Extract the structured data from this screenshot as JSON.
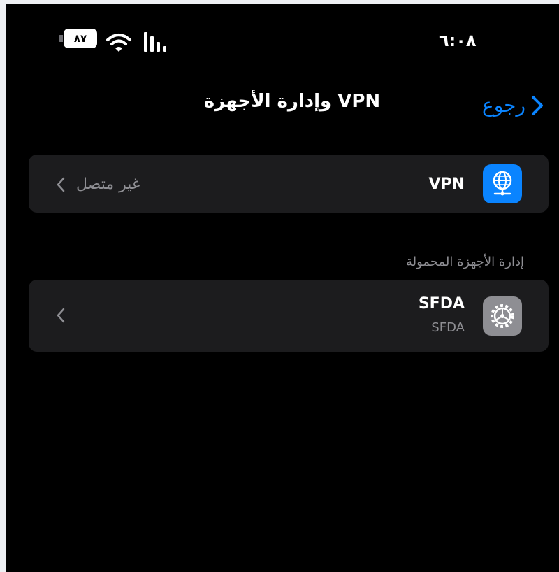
{
  "status_bar": {
    "battery": "٨٧",
    "time": "٦:٠٨",
    "icons": [
      "battery-icon",
      "wifi-icon",
      "cellular-signal-icon"
    ]
  },
  "nav": {
    "back_label": "رجوع",
    "title": "VPN وإدارة الأجهزة"
  },
  "vpn_row": {
    "icon": "globe-network-icon",
    "title": "VPN",
    "status": "غير متصل"
  },
  "device_management": {
    "header": "إدارة الأجهزة المحمولة",
    "profile": {
      "icon": "gear-icon",
      "title": "SFDA",
      "subtitle": "SFDA"
    }
  },
  "colors": {
    "accent": "#0a84ff",
    "background": "#000000",
    "cell": "#1c1c1e",
    "secondary_text": "#8e8e93"
  }
}
